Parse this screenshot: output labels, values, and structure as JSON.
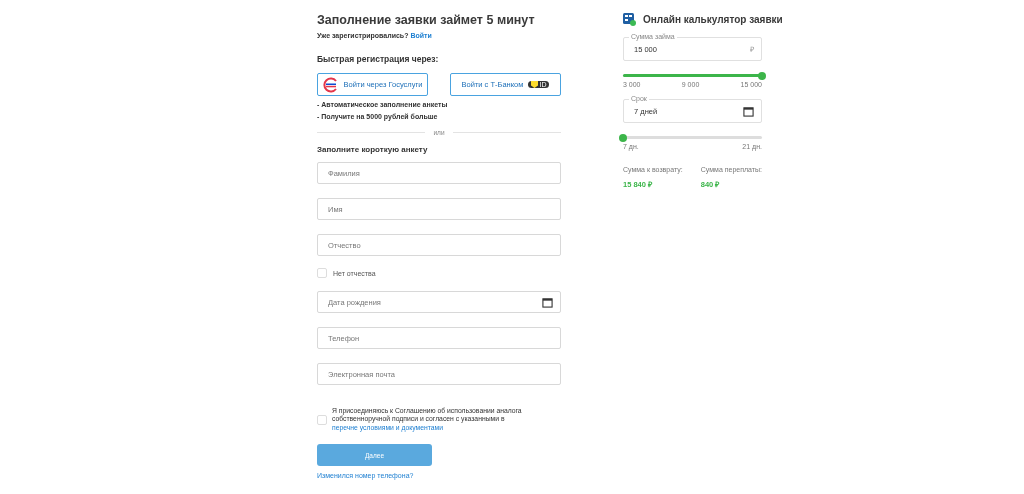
{
  "form": {
    "title": "Заполнение заявки займет 5 минут",
    "login_prompt": "Уже зарегистрировались?",
    "login_link": "Войти",
    "quick_title": "Быстрая регистрация через:",
    "quick_buttons": [
      {
        "kind": "gosuslugi",
        "label": "Войти через Госуслуги"
      },
      {
        "kind": "tbank",
        "label": "Войти с Т-Банком",
        "badge": "ID"
      }
    ],
    "benefits": [
      "- Автоматическое заполнение анкеты",
      "- Получите на 5000 рублей больше"
    ],
    "divider": "или",
    "short_title": "Заполните короткую анкету",
    "fields": [
      {
        "kind": "text",
        "placeholder": "Фамилия"
      },
      {
        "kind": "text",
        "placeholder": "Имя"
      },
      {
        "kind": "text",
        "placeholder": "Отчество"
      },
      {
        "kind": "checkbox",
        "label": "Нет отчества",
        "checked": false
      },
      {
        "kind": "date",
        "placeholder": "Дата рождения"
      },
      {
        "kind": "text",
        "placeholder": "Телефон"
      },
      {
        "kind": "text",
        "placeholder": "Электронная почта"
      }
    ],
    "consent": {
      "checked": false,
      "text": "Я присоединяюсь к Соглашению об использовании аналога собственноручной подписи и согласен с указанными в",
      "link": "перечне условиями и документами"
    },
    "submit": {
      "label": "Далее",
      "disabled": true
    },
    "phone_link": "Изменился номер телефона?"
  },
  "calculator": {
    "title": "Онлайн калькулятор заявки",
    "amount": {
      "label": "Сумма займа",
      "value": "15 000",
      "unit": "₽",
      "level": 1,
      "ticks": [
        "3 000",
        "9 000",
        "15 000"
      ]
    },
    "term": {
      "label": "Срок",
      "value": "7 дней",
      "level": 0,
      "ticks": [
        "7 дн.",
        "21 дн."
      ]
    },
    "summary": [
      {
        "label": "Сумма к возврату:",
        "value": "15 840 ₽"
      },
      {
        "label": "Сумма переплаты:",
        "value": "840 ₽"
      }
    ]
  }
}
